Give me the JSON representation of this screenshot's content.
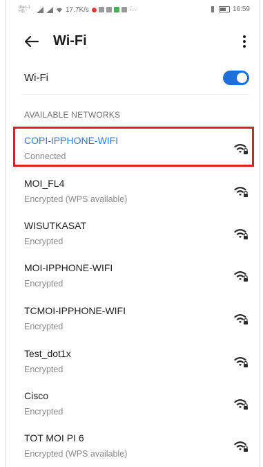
{
  "status_bar": {
    "carrier_text": "dtac-1 HD",
    "speed": "17.7K/s",
    "more": "···",
    "battery_text": "",
    "time": "16:59"
  },
  "app_bar": {
    "title": "Wi-Fi"
  },
  "wifi_toggle": {
    "label": "Wi-Fi",
    "enabled": true
  },
  "section_header": "AVAILABLE NETWORKS",
  "networks": [
    {
      "name": "COPI-IPPHONE-WIFI",
      "status": "Connected",
      "secured": true
    },
    {
      "name": "MOI_FL4",
      "status": "Encrypted (WPS available)",
      "secured": true
    },
    {
      "name": "WISUTKASAT",
      "status": "Encrypted",
      "secured": true
    },
    {
      "name": "MOI-IPPHONE-WIFI",
      "status": "Encrypted",
      "secured": true
    },
    {
      "name": "TCMOI-IPPHONE-WIFI",
      "status": "Encrypted",
      "secured": true
    },
    {
      "name": "Test_dot1x",
      "status": "Encrypted",
      "secured": true
    },
    {
      "name": "Cisco",
      "status": "Encrypted",
      "secured": true
    },
    {
      "name": "TOT MOI PI 6",
      "status": "Encrypted (WPS available)",
      "secured": true
    }
  ],
  "colors": {
    "accent": "#1e6fd9",
    "connected_text": "#2979d8",
    "highlight": "#e02020"
  },
  "icons": {
    "back": "arrow-left-icon",
    "overflow": "more-vertical-icon",
    "wifi": "wifi-locked-icon"
  }
}
